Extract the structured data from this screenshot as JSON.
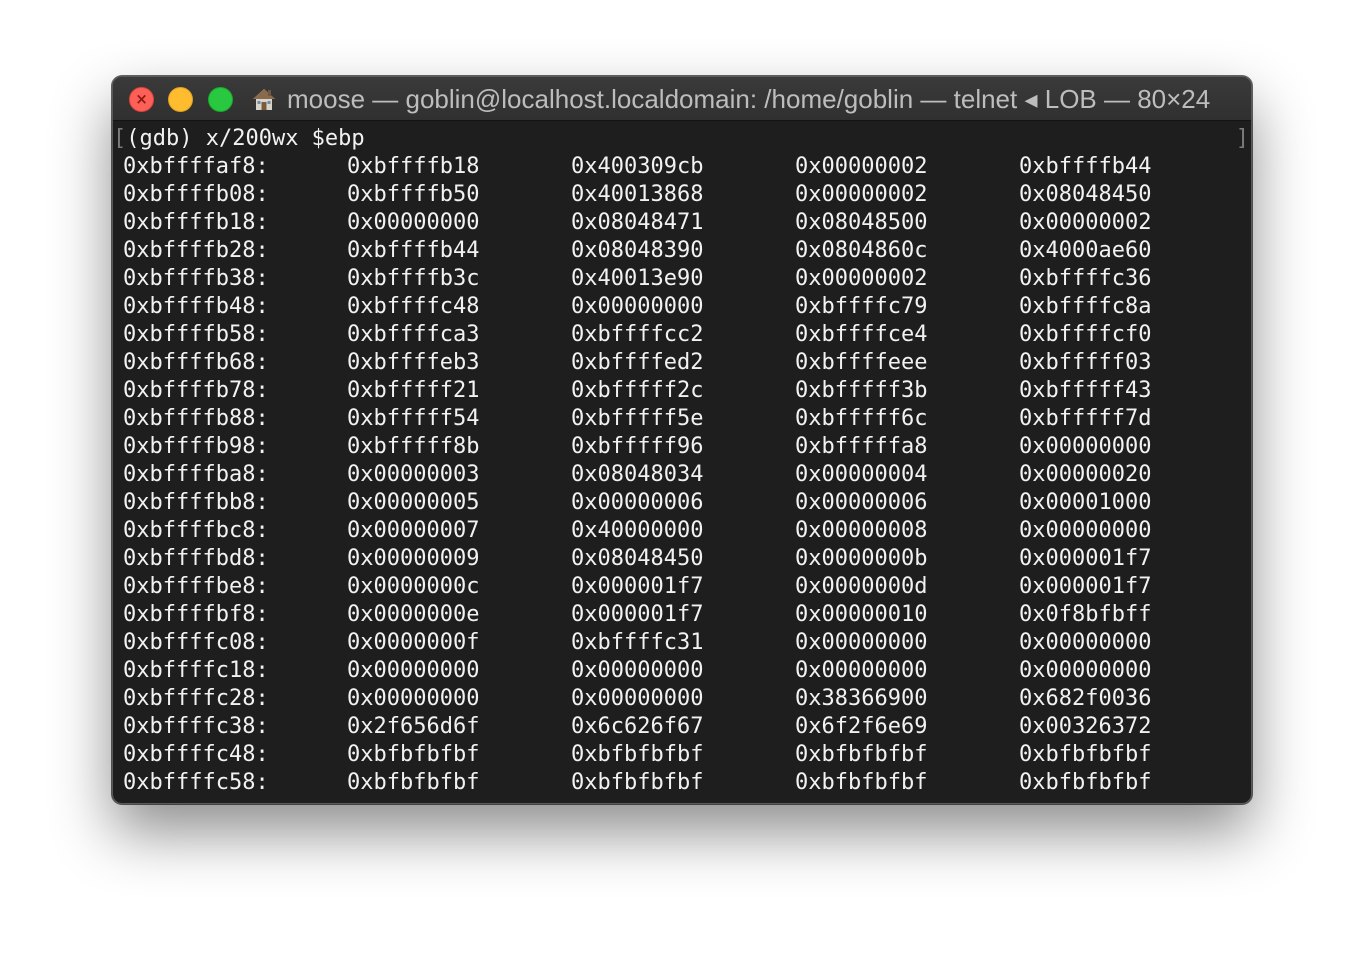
{
  "window": {
    "title": "moose — goblin@localhost.localdomain: /home/goblin — telnet ◂ LOB — 80×24"
  },
  "terminal": {
    "command": "(gdb) x/200wx $ebp",
    "bracket_open": "[",
    "bracket_close": "]",
    "rows": [
      {
        "addr": "0xbffffaf8:",
        "values": [
          "0xbffffb18",
          "0x400309cb",
          "0x00000002",
          "0xbffffb44"
        ]
      },
      {
        "addr": "0xbffffb08:",
        "values": [
          "0xbffffb50",
          "0x40013868",
          "0x00000002",
          "0x08048450"
        ]
      },
      {
        "addr": "0xbffffb18:",
        "values": [
          "0x00000000",
          "0x08048471",
          "0x08048500",
          "0x00000002"
        ]
      },
      {
        "addr": "0xbffffb28:",
        "values": [
          "0xbffffb44",
          "0x08048390",
          "0x0804860c",
          "0x4000ae60"
        ]
      },
      {
        "addr": "0xbffffb38:",
        "values": [
          "0xbffffb3c",
          "0x40013e90",
          "0x00000002",
          "0xbffffc36"
        ]
      },
      {
        "addr": "0xbffffb48:",
        "values": [
          "0xbffffc48",
          "0x00000000",
          "0xbffffc79",
          "0xbffffc8a"
        ]
      },
      {
        "addr": "0xbffffb58:",
        "values": [
          "0xbffffca3",
          "0xbffffcc2",
          "0xbffffce4",
          "0xbffffcf0"
        ]
      },
      {
        "addr": "0xbffffb68:",
        "values": [
          "0xbffffeb3",
          "0xbffffed2",
          "0xbffffeee",
          "0xbfffff03"
        ]
      },
      {
        "addr": "0xbffffb78:",
        "values": [
          "0xbfffff21",
          "0xbfffff2c",
          "0xbfffff3b",
          "0xbfffff43"
        ]
      },
      {
        "addr": "0xbffffb88:",
        "values": [
          "0xbfffff54",
          "0xbfffff5e",
          "0xbfffff6c",
          "0xbfffff7d"
        ]
      },
      {
        "addr": "0xbffffb98:",
        "values": [
          "0xbfffff8b",
          "0xbfffff96",
          "0xbfffffa8",
          "0x00000000"
        ]
      },
      {
        "addr": "0xbffffba8:",
        "values": [
          "0x00000003",
          "0x08048034",
          "0x00000004",
          "0x00000020"
        ]
      },
      {
        "addr": "0xbffffbb8:",
        "values": [
          "0x00000005",
          "0x00000006",
          "0x00000006",
          "0x00001000"
        ]
      },
      {
        "addr": "0xbffffbc8:",
        "values": [
          "0x00000007",
          "0x40000000",
          "0x00000008",
          "0x00000000"
        ]
      },
      {
        "addr": "0xbffffbd8:",
        "values": [
          "0x00000009",
          "0x08048450",
          "0x0000000b",
          "0x000001f7"
        ]
      },
      {
        "addr": "0xbffffbe8:",
        "values": [
          "0x0000000c",
          "0x000001f7",
          "0x0000000d",
          "0x000001f7"
        ]
      },
      {
        "addr": "0xbffffbf8:",
        "values": [
          "0x0000000e",
          "0x000001f7",
          "0x00000010",
          "0x0f8bfbff"
        ]
      },
      {
        "addr": "0xbffffc08:",
        "values": [
          "0x0000000f",
          "0xbffffc31",
          "0x00000000",
          "0x00000000"
        ]
      },
      {
        "addr": "0xbffffc18:",
        "values": [
          "0x00000000",
          "0x00000000",
          "0x00000000",
          "0x00000000"
        ]
      },
      {
        "addr": "0xbffffc28:",
        "values": [
          "0x00000000",
          "0x00000000",
          "0x38366900",
          "0x682f0036"
        ]
      },
      {
        "addr": "0xbffffc38:",
        "values": [
          "0x2f656d6f",
          "0x6c626f67",
          "0x6f2f6e69",
          "0x00326372"
        ]
      },
      {
        "addr": "0xbffffc48:",
        "values": [
          "0xbfbfbfbf",
          "0xbfbfbfbf",
          "0xbfbfbfbf",
          "0xbfbfbfbf"
        ]
      },
      {
        "addr": "0xbffffc58:",
        "values": [
          "0xbfbfbfbf",
          "0xbfbfbfbf",
          "0xbfbfbfbf",
          "0xbfbfbfbf"
        ]
      }
    ]
  },
  "icons": {
    "close": "close-icon",
    "minimize": "minimize-icon",
    "zoom": "zoom-icon",
    "home": "home-icon"
  },
  "colors": {
    "close": "#fe5f57",
    "minimize": "#febc2e",
    "zoom": "#28c840",
    "terminal_bg": "#1e1e1e",
    "terminal_fg": "#f2f2f2"
  }
}
